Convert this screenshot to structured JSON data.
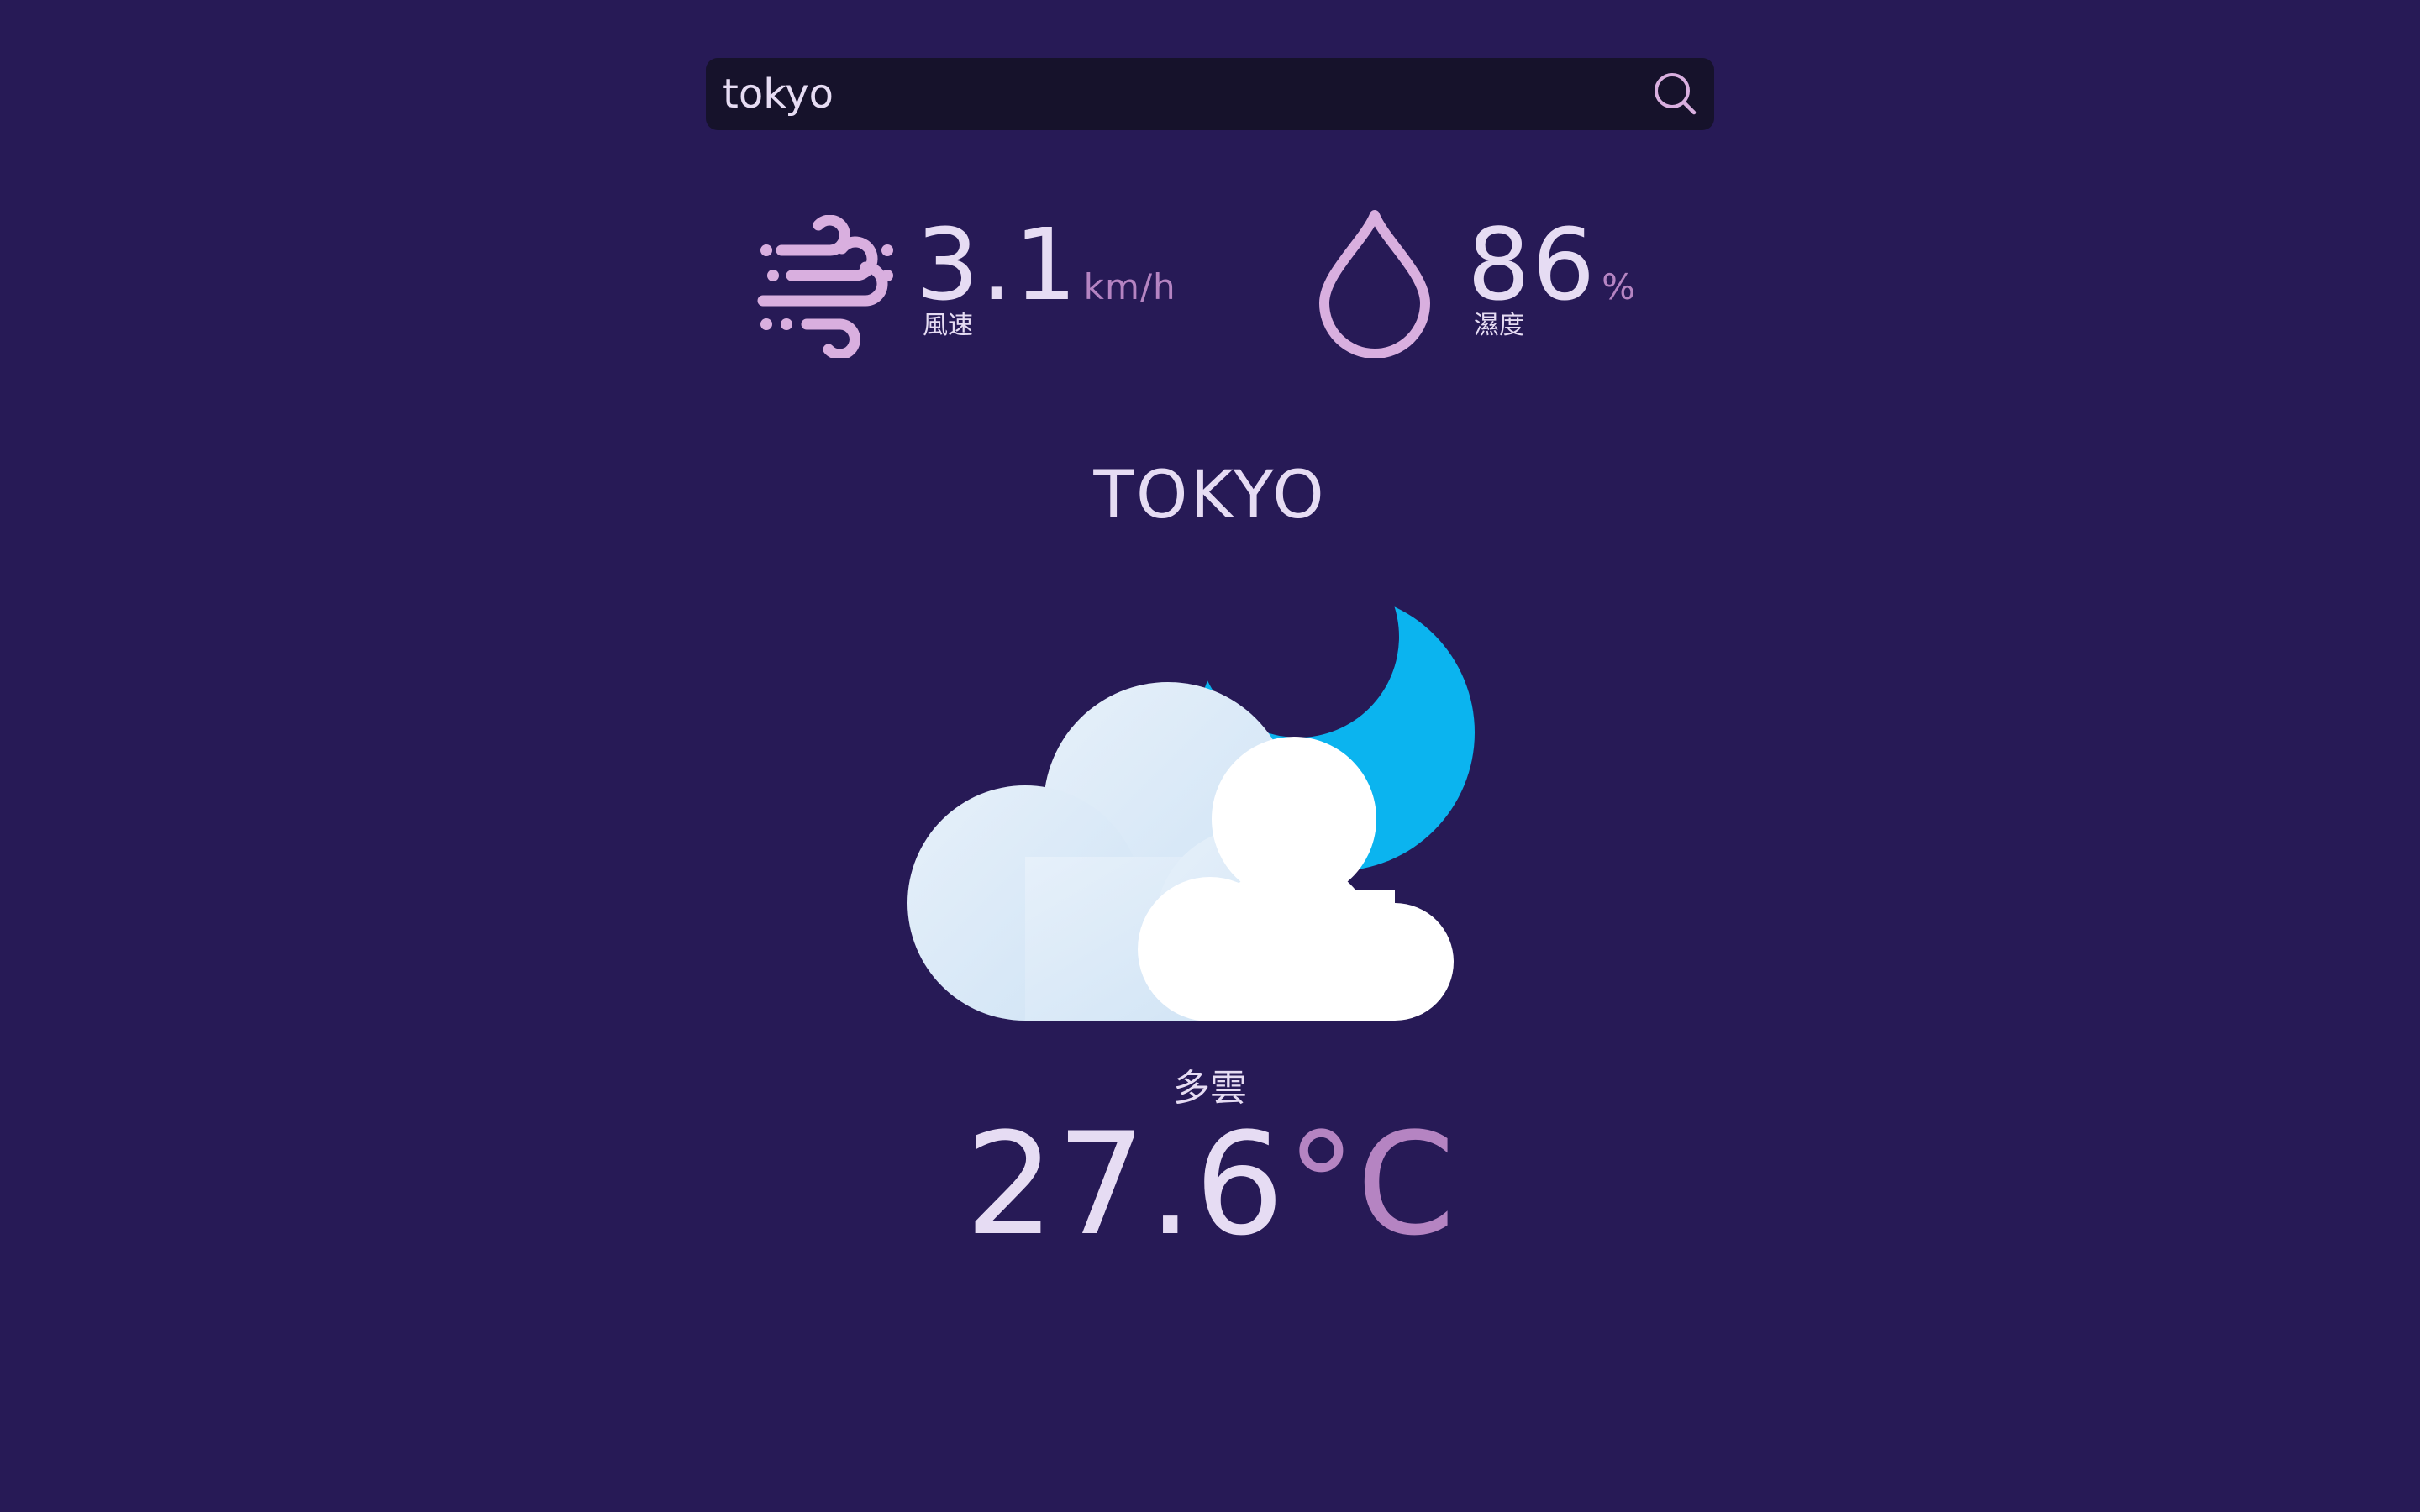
{
  "search": {
    "value": "tokyo",
    "placeholder": ""
  },
  "stats": {
    "wind": {
      "value": "3.1",
      "unit": "km/h",
      "label": "風速",
      "icon": "wind-icon"
    },
    "humidity": {
      "value": "86",
      "unit": "%",
      "label": "濕度",
      "icon": "water-drop-icon"
    }
  },
  "city": "TOKYO",
  "weather": {
    "condition": "多雲",
    "icon": "partly-cloudy-night-icon",
    "temperature": "27.6",
    "temperature_unit": "°C"
  },
  "colors": {
    "background": "#271a56",
    "search_background": "#16122b",
    "text_primary": "#e6dcf3",
    "text_accent": "#b584c2",
    "icon_accent": "#d9afdf",
    "moon": "#0bb4ef"
  }
}
